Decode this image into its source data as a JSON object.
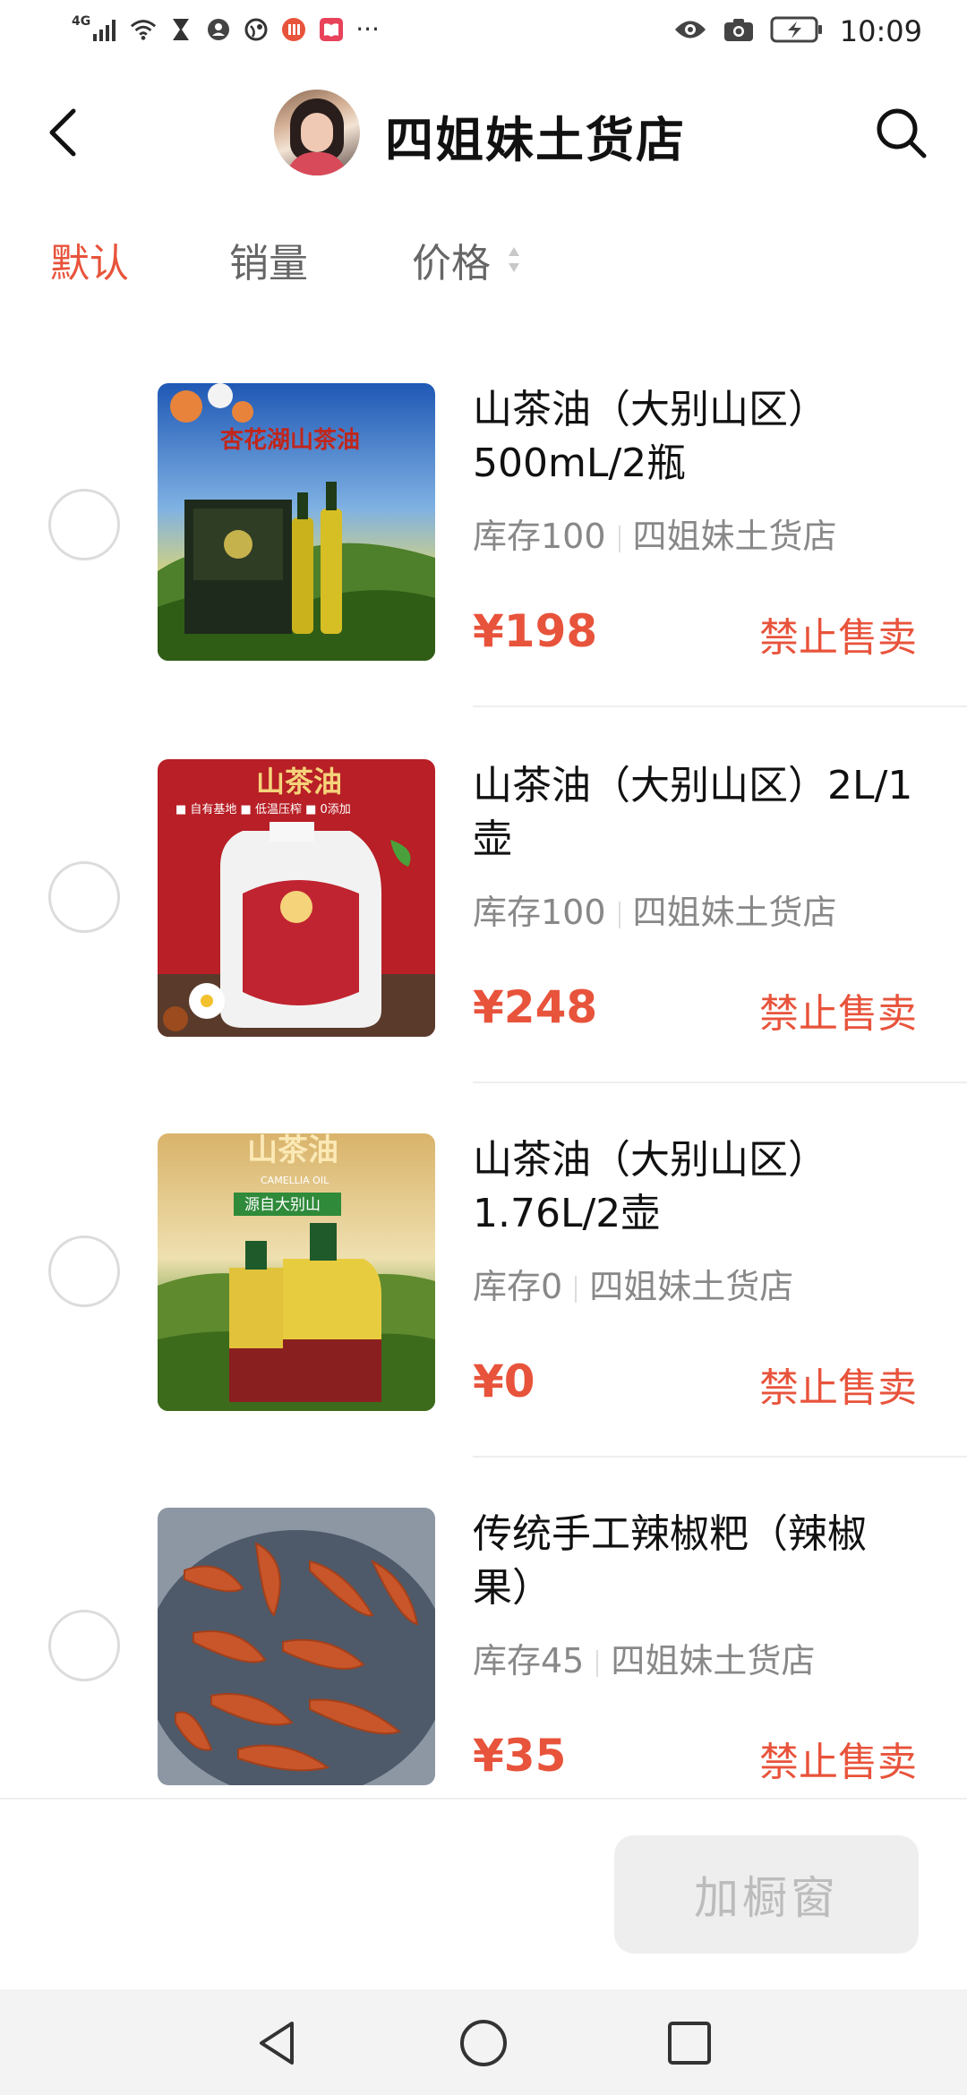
{
  "status_bar": {
    "network": "4G",
    "time": "10:09",
    "more": "···",
    "left_icons": [
      "signal-icon",
      "wifi-icon",
      "hourglass-icon",
      "contact-icon",
      "globe-icon",
      "app-icon",
      "book-icon"
    ],
    "right_icons": [
      "eye-icon",
      "camera-icon",
      "battery-icon"
    ]
  },
  "header": {
    "shop_name": "四姐妹土货店"
  },
  "tabs": [
    {
      "label": "默认",
      "active": true
    },
    {
      "label": "销量",
      "active": false
    },
    {
      "label": "价格",
      "active": false
    }
  ],
  "products": [
    {
      "title": "山茶油（大别山区）500mL/2瓶",
      "stock": "库存100",
      "shop": "四姐妹土货店",
      "price": "¥198",
      "status": "禁止售卖",
      "image_text": "杏花湖山茶油"
    },
    {
      "title": "山茶油（大别山区）2L/1壶",
      "stock": "库存100",
      "shop": "四姐妹土货店",
      "price": "¥248",
      "status": "禁止售卖",
      "image_text": "山茶油",
      "image_sub": "■ 自有基地  ■ 低温压榨  ■ 0添加"
    },
    {
      "title": "山茶油（大别山区）1.76L/2壶",
      "stock": "库存0",
      "shop": "四姐妹土货店",
      "price": "¥0",
      "status": "禁止售卖",
      "image_text": "山茶油",
      "image_sub": "CAMELLIA OIL",
      "image_ribbon": "源自大别山"
    },
    {
      "title": "传统手工辣椒粑（辣椒果）",
      "stock": "库存45",
      "shop": "四姐妹土货店",
      "price": "¥35",
      "status": "禁止售卖"
    }
  ],
  "action_bar": {
    "add_window_label": "加橱窗"
  },
  "colors": {
    "accent": "#e8533b",
    "muted": "#888888",
    "divider": "#eeeeee",
    "disabled_bg": "#eeeeee",
    "disabled_text": "#bcbcbc"
  }
}
